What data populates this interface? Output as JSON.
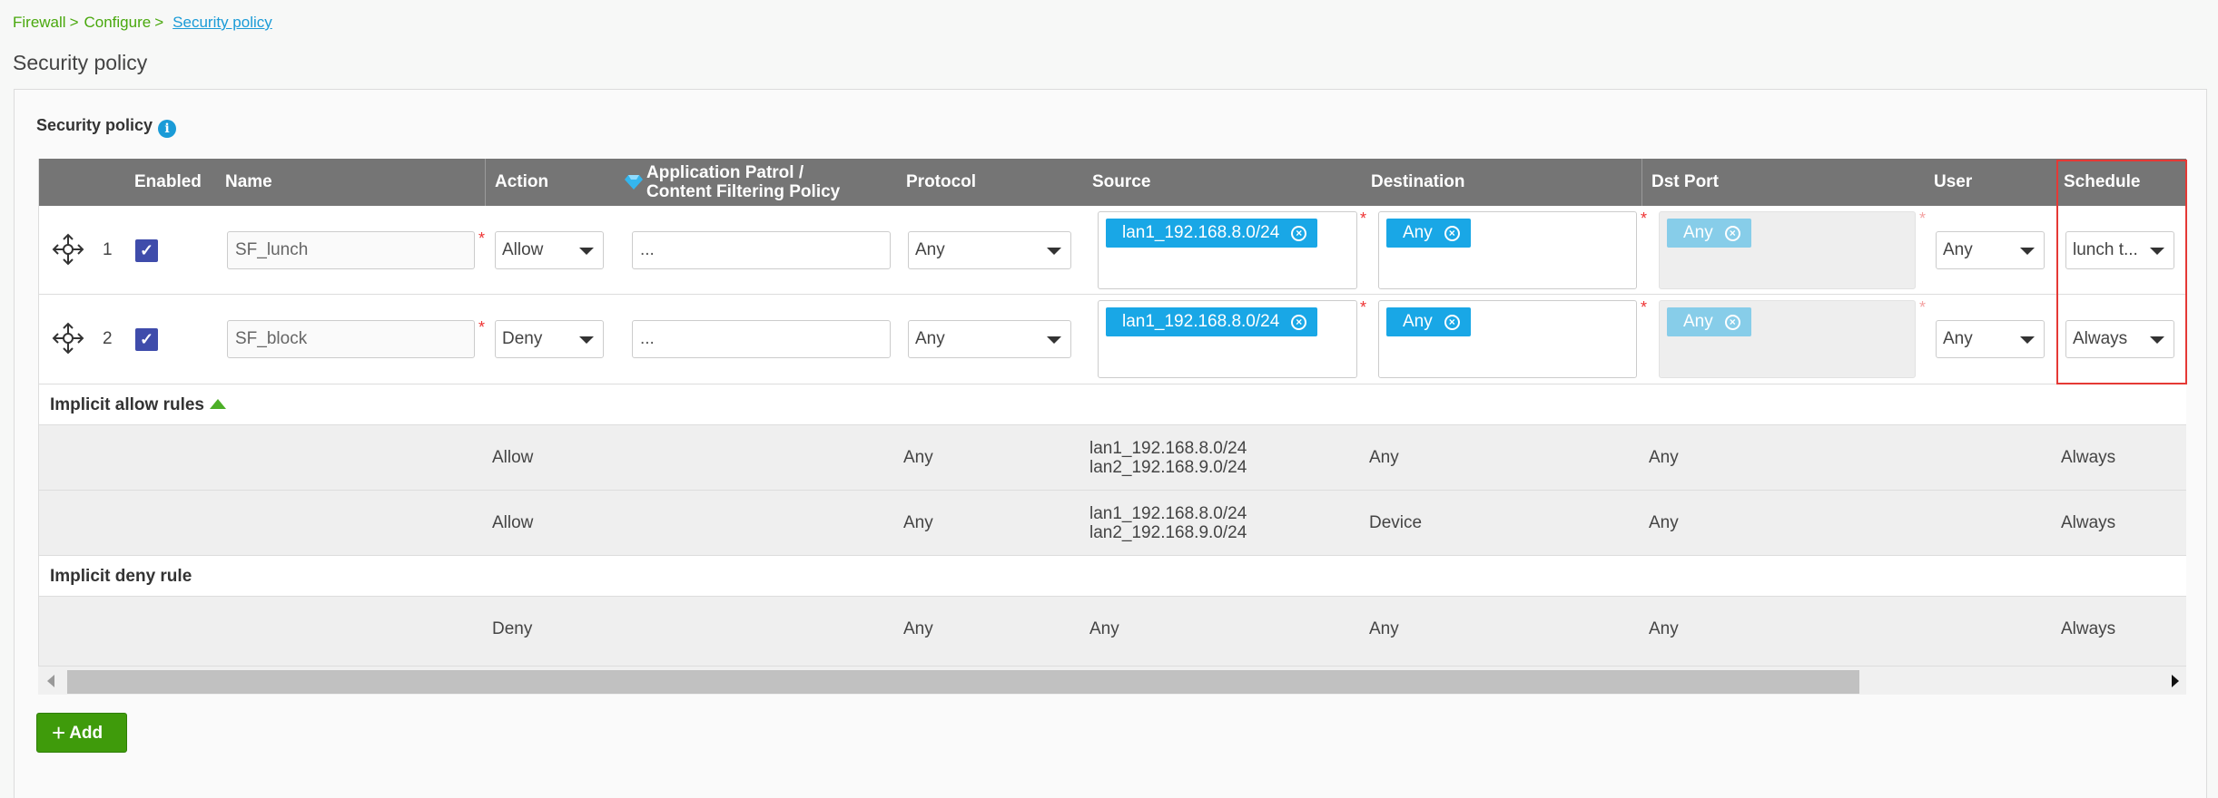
{
  "breadcrumb": {
    "items": [
      "Firewall",
      "Configure"
    ],
    "separator": ">",
    "current": "Security policy"
  },
  "page_title": "Security policy",
  "section_title": "Security policy",
  "info_icon": "i",
  "table": {
    "headers": {
      "enabled": "Enabled",
      "name": "Name",
      "action": "Action",
      "app_line1": "Application Patrol /",
      "app_line2": "Content Filtering Policy",
      "protocol": "Protocol",
      "source": "Source",
      "destination": "Destination",
      "dst_port": "Dst Port",
      "user": "User",
      "schedule": "Schedule"
    },
    "rules": [
      {
        "num": "1",
        "name": "SF_lunch",
        "action": "Allow",
        "app": "...",
        "protocol": "Any",
        "source": "lan1_192.168.8.0/24",
        "destination": "Any",
        "dst_port": "Any",
        "user": "Any",
        "schedule": "lunch t..."
      },
      {
        "num": "2",
        "name": "SF_block",
        "action": "Deny",
        "app": "...",
        "protocol": "Any",
        "source": "lan1_192.168.8.0/24",
        "destination": "Any",
        "dst_port": "Any",
        "user": "Any",
        "schedule": "Always"
      }
    ],
    "implicit_allow_label": "Implicit allow rules",
    "implicit_allow": [
      {
        "action": "Allow",
        "protocol": "Any",
        "source_line1": "lan1_192.168.8.0/24",
        "source_line2": "lan2_192.168.9.0/24",
        "destination": "Any",
        "dst_port": "Any",
        "schedule": "Always"
      },
      {
        "action": "Allow",
        "protocol": "Any",
        "source_line1": "lan1_192.168.8.0/24",
        "source_line2": "lan2_192.168.9.0/24",
        "destination": "Device",
        "dst_port": "Any",
        "schedule": "Always"
      }
    ],
    "implicit_deny_label": "Implicit deny rule",
    "implicit_deny": {
      "action": "Deny",
      "protocol": "Any",
      "source": "Any",
      "destination": "Any",
      "dst_port": "Any",
      "schedule": "Always"
    }
  },
  "add_button": "Add",
  "required_mark": "*",
  "tag_remove": "×",
  "checkmark": "✓",
  "add_plus": "+",
  "icons": {
    "move": "move-arrows-icon",
    "info": "info-icon",
    "diamond": "diamond-icon"
  },
  "colors": {
    "accent_green": "#3f9b0b",
    "tag_blue": "#19a7e6",
    "header_gray": "#757575",
    "checkbox_blue": "#3f4cab",
    "highlight_red": "#e53935"
  }
}
